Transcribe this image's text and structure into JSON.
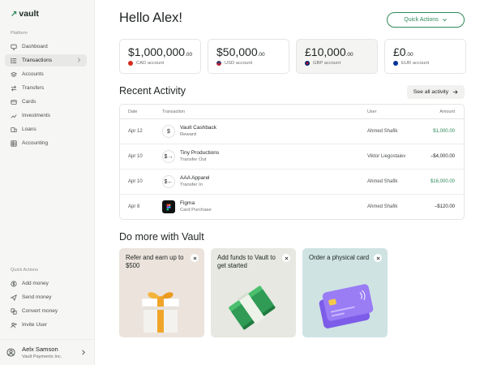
{
  "app": {
    "logo": "vault"
  },
  "sidebar": {
    "platform_label": "Platform",
    "items": [
      {
        "label": "Dashboard",
        "icon": "monitor-icon"
      },
      {
        "label": "Transactions",
        "icon": "list-icon",
        "active": true
      },
      {
        "label": "Accounts",
        "icon": "stack-icon"
      },
      {
        "label": "Transfers",
        "icon": "transfer-icon"
      },
      {
        "label": "Cards",
        "icon": "card-icon"
      },
      {
        "label": "Investments",
        "icon": "chart-icon"
      },
      {
        "label": "Loans",
        "icon": "loan-icon"
      },
      {
        "label": "Accounting",
        "icon": "table-icon"
      }
    ],
    "quick_label": "Quick Actions",
    "quick_items": [
      {
        "label": "Add money",
        "icon": "dollar-circle-icon"
      },
      {
        "label": "Send money",
        "icon": "send-icon"
      },
      {
        "label": "Convert money",
        "icon": "convert-icon"
      },
      {
        "label": "Invite User",
        "icon": "user-plus-icon"
      }
    ],
    "user": {
      "name": "Aelx Samson",
      "org": "Vault Payments Inc."
    }
  },
  "header": {
    "greeting": "Hello Alex!",
    "quick_actions": "Quick Actions"
  },
  "balances": [
    {
      "amount": "$1,000,000",
      "cents": ".00",
      "account": "CAD account",
      "flag_color": "#d52b1e"
    },
    {
      "amount": "$50,000",
      "cents": ".00",
      "account": "USD account",
      "flag_color": "#3c3b6e"
    },
    {
      "amount": "£10,000",
      "cents": ".00",
      "account": "GBP account",
      "flag_color": "#012169"
    },
    {
      "amount": "£0",
      "cents": ".00",
      "account": "EUR account",
      "flag_color": "#003399"
    }
  ],
  "activity": {
    "title": "Recent Activity",
    "see_all": "See all activity",
    "columns": {
      "date": "Date",
      "transaction": "Transaction",
      "user": "User",
      "amount": "Amount"
    },
    "rows": [
      {
        "date": "Apr 12",
        "icon": "$",
        "name": "Vault Cashback",
        "type": "Reward",
        "user": "Ahmed Shafik",
        "amount": "$1,000.00",
        "positive": true
      },
      {
        "date": "Apr 10",
        "icon": "$→",
        "name": "Tiny Productions",
        "type": "Transfer Out",
        "user": "Viktor Liegostaiev",
        "amount": "–$4,000.00",
        "positive": false
      },
      {
        "date": "Apr 10",
        "icon": "$←",
        "name": "AAA Apparel",
        "type": "Transfer In",
        "user": "Ahmed Shafik",
        "amount": "$16,000.00",
        "positive": true
      },
      {
        "date": "Apr 8",
        "icon": "",
        "name": "Figma",
        "type": "Card Purchase",
        "user": "Ahmed Shafik",
        "amount": "–$120.00",
        "positive": false
      }
    ]
  },
  "promos": {
    "title": "Do more with Vault",
    "items": [
      {
        "text": "Refer and earn up to $500",
        "bg": "#ebe3dc"
      },
      {
        "text": "Add funds to Vault to get started",
        "bg": "#e6e8e1"
      },
      {
        "text": "Order a physical card",
        "bg": "#cfe3e3"
      }
    ]
  },
  "colors": {
    "accent": "#2f8a5a",
    "sidebar_bg": "#f6f6f5"
  }
}
